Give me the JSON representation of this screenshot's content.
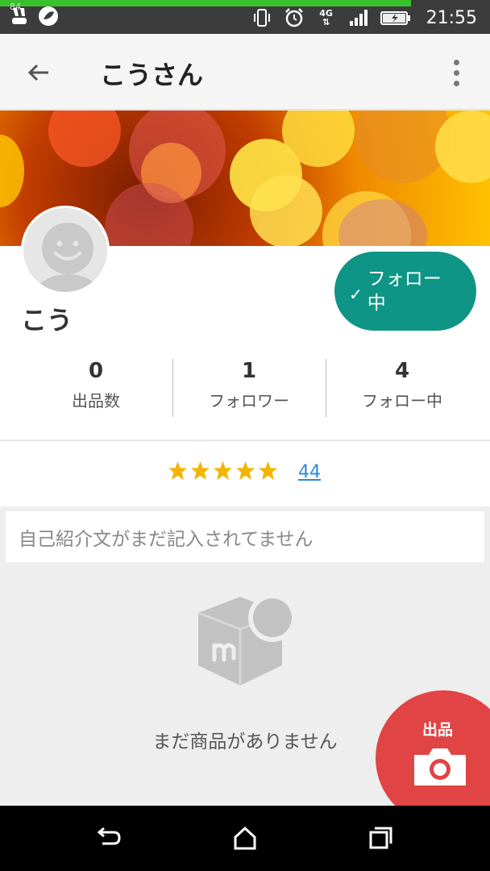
{
  "status_bar": {
    "battery_small": "84",
    "time": "21:55",
    "network": "4G",
    "icons": [
      "signal-bars-icon",
      "vibrate-icon",
      "alarm-icon",
      "battery-icon"
    ]
  },
  "app_bar": {
    "title": "こうさん",
    "back_icon": "arrow-left-icon",
    "more_icon": "more-vertical-icon"
  },
  "profile": {
    "name": "こう",
    "follow_button_label": "フォロー中",
    "stats": [
      {
        "value": "0",
        "label": "出品数"
      },
      {
        "value": "1",
        "label": "フォロワー"
      },
      {
        "value": "4",
        "label": "フォロー中"
      }
    ]
  },
  "rating": {
    "stars": 5,
    "review_count": "44"
  },
  "bio": {
    "text": "自己紹介文がまだ記入されてません"
  },
  "empty_state": {
    "text": "まだ商品がありません"
  },
  "fab": {
    "label": "出品",
    "icon": "camera-icon"
  },
  "nav_bar": {
    "items": [
      "back-icon",
      "home-icon",
      "recents-icon"
    ]
  },
  "colors": {
    "accent_teal": "#0f9585",
    "fab_red": "#e04444",
    "star_yellow": "#f5b400",
    "link_blue": "#2c8ad8"
  }
}
